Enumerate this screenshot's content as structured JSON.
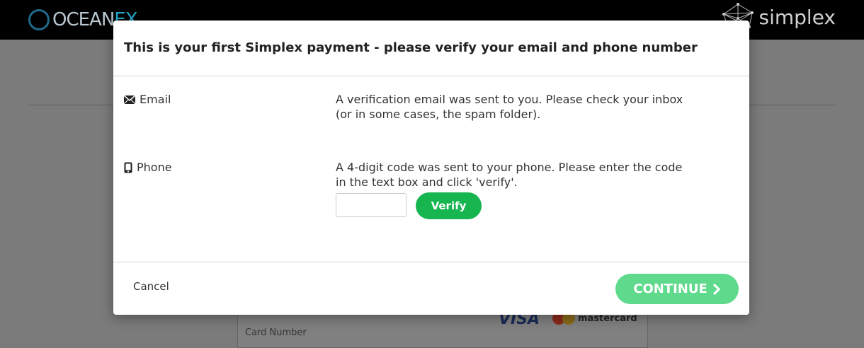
{
  "header": {
    "left_logo": {
      "text_main": "OCEAN",
      "text_accent": "EX",
      "icon": "oceanex-logo-icon"
    },
    "right_logo": {
      "text": "simplex",
      "icon": "simplex-mesh-icon"
    }
  },
  "background": {
    "card_label": "Card Number",
    "card_brands": [
      "VISA",
      "mastercard"
    ]
  },
  "modal": {
    "title": "This is your first Simplex payment - please verify your email and phone number",
    "email": {
      "icon": "envelope-icon",
      "label": "Email",
      "message_line1": "A verification email was sent to you. Please check your inbox",
      "message_line2": "(or in some cases, the spam folder)."
    },
    "phone": {
      "icon": "mobile-phone-icon",
      "label": "Phone",
      "message_line1": "A 4-digit code was sent to your phone. Please enter the code",
      "message_line2": "in the text box and click 'verify'.",
      "code_value": "",
      "verify_label": "Verify"
    },
    "footer": {
      "cancel_label": "Cancel",
      "continue_label": "CONTINUE",
      "continue_icon": "chevron-right-icon"
    }
  },
  "colors": {
    "verify_green": "#16b550",
    "continue_green": "#5fd98b",
    "top_bar": "#000000"
  }
}
